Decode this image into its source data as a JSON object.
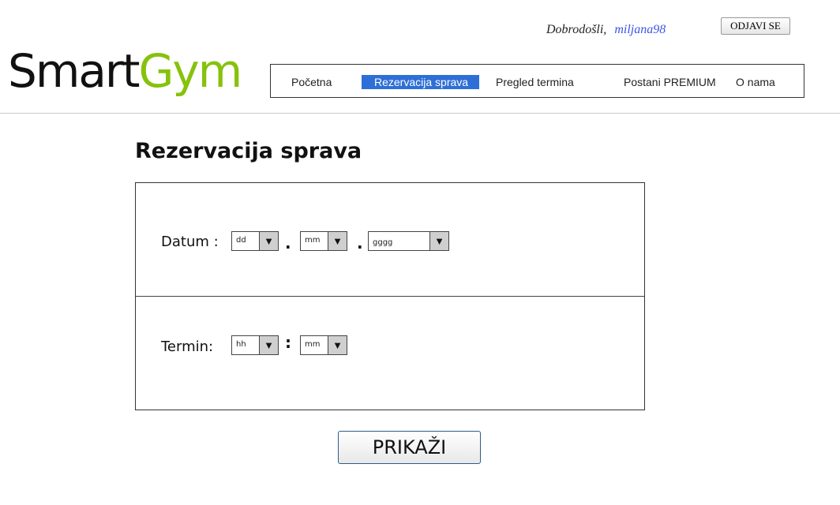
{
  "header": {
    "welcome_text": "Dobrodošli,",
    "username": "miljana98",
    "logout_label": "ODJAVI SE",
    "logo_part1": "Smart",
    "logo_part2": "Gym",
    "logo_accent_color": "#86c20c"
  },
  "nav": {
    "items": [
      {
        "label": "Početna",
        "active": false
      },
      {
        "label": "Rezervacija sprava",
        "active": true
      },
      {
        "label": "Pregled termina",
        "active": false
      },
      {
        "label": "Postani PREMIUM",
        "active": false
      },
      {
        "label": "O nama",
        "active": false
      }
    ],
    "active_color": "#2d6fd6"
  },
  "main": {
    "title": "Rezervacija sprava",
    "date": {
      "label": "Datum :",
      "day_value": "dd",
      "month_value": "mm",
      "year_value": "gggg",
      "separator": "."
    },
    "time": {
      "label": "Termin:",
      "hour_value": "hh",
      "minute_value": "mm",
      "separator": ":"
    },
    "dropdown_icon": "▼",
    "show_button_label": "PRIKAŽI"
  }
}
